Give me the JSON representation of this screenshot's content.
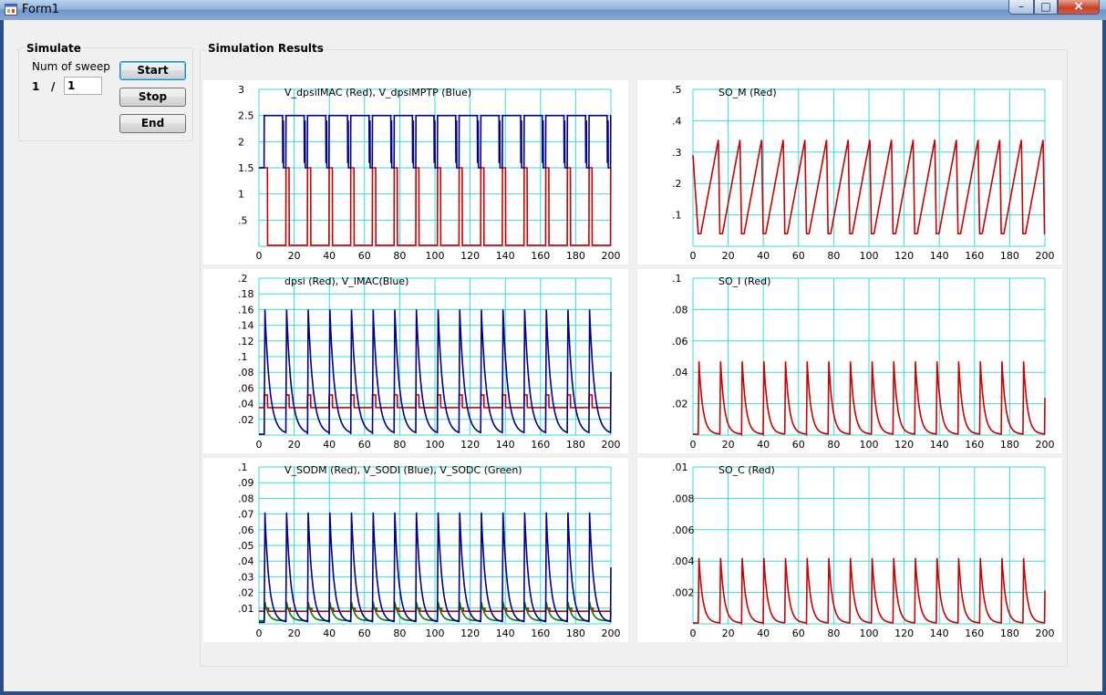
{
  "window": {
    "title": "Form1",
    "minimize_glyph": "–",
    "maximize_glyph": "□",
    "close_glyph": "×"
  },
  "simulate": {
    "group_label": "Simulate",
    "sweep_label": "Num of sweep",
    "sweep_current": "1",
    "sweep_separator": "/",
    "sweep_total": "1",
    "start_label": "Start",
    "stop_label": "Stop",
    "end_label": "End"
  },
  "results": {
    "group_label": "Simulation Results"
  },
  "colors": {
    "red": "#cc0000",
    "blue": "#00008b",
    "green": "#008000",
    "grid": "#33dddd"
  },
  "chart_data": [
    {
      "type": "line",
      "title": "V_dpsiIMAC (Red), V_dpsiMPTP (Blue)",
      "xlim": [
        0,
        200
      ],
      "ylim": [
        0,
        3
      ],
      "xticks": [
        "0",
        "20",
        "40",
        "60",
        "80",
        "100",
        "120",
        "140",
        "160",
        "180",
        "200"
      ],
      "yticks": [
        "3",
        "2.5",
        "2",
        "1.5",
        "1",
        ".5"
      ],
      "period": 12.3,
      "phase": 3,
      "series": [
        {
          "color": "red",
          "kind": "rect",
          "high": 1.5,
          "low": 0.02,
          "duty": 0.15,
          "pre_drop": 0.6
        },
        {
          "color": "blue",
          "kind": "rect",
          "high": 2.5,
          "low": 1.5,
          "duty": 0.85,
          "rise_in": 0.35
        }
      ]
    },
    {
      "type": "line",
      "title": "SO_M (Red)",
      "xlim": [
        0,
        200
      ],
      "ylim": [
        0,
        0.5
      ],
      "xticks": [
        "0",
        "20",
        "40",
        "60",
        "80",
        "100",
        "120",
        "140",
        "160",
        "180",
        "200"
      ],
      "yticks": [
        ".5",
        ".4",
        ".3",
        ".2",
        ".1"
      ],
      "period": 12.3,
      "phase": 3,
      "series": [
        {
          "color": "red",
          "kind": "saw",
          "peak": 0.34,
          "base": 0.04,
          "start": 0.29
        }
      ]
    },
    {
      "type": "line",
      "title": "dpsi (Red), V_IMAC(Blue)",
      "xlim": [
        0,
        200
      ],
      "ylim": [
        0,
        0.2
      ],
      "xticks": [
        "0",
        "20",
        "40",
        "60",
        "80",
        "100",
        "120",
        "140",
        "160",
        "180",
        "200"
      ],
      "yticks": [
        ".2",
        ".18",
        ".16",
        ".14",
        ".12",
        ".1",
        ".08",
        ".06",
        ".04",
        ".02"
      ],
      "period": 12.3,
      "phase": 3,
      "series": [
        {
          "color": "red",
          "kind": "rect",
          "high": 0.051,
          "low": 0.035,
          "duty": 0.15
        },
        {
          "color": "blue",
          "kind": "spike",
          "peak": 0.16,
          "base": 0.001,
          "width": 2.8
        }
      ]
    },
    {
      "type": "line",
      "title": "SO_I (Red)",
      "xlim": [
        0,
        200
      ],
      "ylim": [
        0,
        0.1
      ],
      "xticks": [
        "0",
        "20",
        "40",
        "60",
        "80",
        "100",
        "120",
        "140",
        "160",
        "180",
        "200"
      ],
      "yticks": [
        ".1",
        ".08",
        ".06",
        ".04",
        ".02"
      ],
      "period": 12.3,
      "phase": 3,
      "series": [
        {
          "color": "red",
          "kind": "spike",
          "peak": 0.047,
          "base": 0.0005,
          "width": 2.2
        }
      ]
    },
    {
      "type": "line",
      "title": "V_SODM (Red), V_SODI (Blue), V_SODC (Green)",
      "xlim": [
        0,
        200
      ],
      "ylim": [
        0,
        0.1
      ],
      "xticks": [
        "0",
        "20",
        "40",
        "60",
        "80",
        "100",
        "120",
        "140",
        "160",
        "180",
        "200"
      ],
      "yticks": [
        ".1",
        ".09",
        ".08",
        ".07",
        ".06",
        ".05",
        ".04",
        ".03",
        ".02",
        ".01"
      ],
      "period": 12.3,
      "phase": 3,
      "series": [
        {
          "color": "red",
          "kind": "rect",
          "high": 0.01,
          "low": 0.008,
          "duty": 0.2
        },
        {
          "color": "green",
          "kind": "spike",
          "peak": 0.014,
          "base": 0.002,
          "width": 2.0
        },
        {
          "color": "blue",
          "kind": "spike",
          "peak": 0.071,
          "base": 0.001,
          "width": 2.4
        }
      ]
    },
    {
      "type": "line",
      "title": "SO_C (Red)",
      "xlim": [
        0,
        200
      ],
      "ylim": [
        0,
        0.01
      ],
      "xticks": [
        "0",
        "20",
        "40",
        "60",
        "80",
        "100",
        "120",
        "140",
        "160",
        "180",
        "200"
      ],
      "yticks": [
        ".01",
        ".008",
        ".006",
        ".004",
        ".002"
      ],
      "period": 12.3,
      "phase": 3,
      "series": [
        {
          "color": "red",
          "kind": "spike",
          "peak": 0.0042,
          "base": 5e-05,
          "width": 2.2
        }
      ]
    }
  ]
}
